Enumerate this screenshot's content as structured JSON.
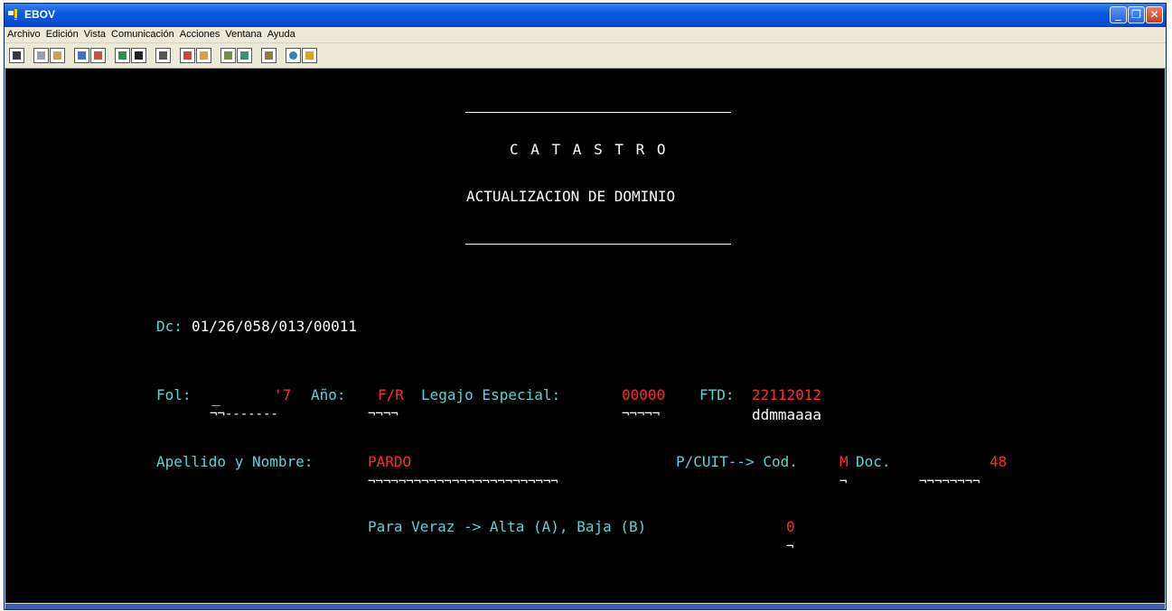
{
  "window": {
    "title": "EBOV",
    "icon": "terminal-app-icon"
  },
  "menu": [
    "Archivo",
    "Edición",
    "Vista",
    "Comunicación",
    "Acciones",
    "Ventana",
    "Ayuda"
  ],
  "toolbar": {
    "count": 20
  },
  "screen": {
    "heading": "C A T A S T R O",
    "subheading": "ACTUALIZACION DE DOMINIO",
    "dc_label": "Dc:",
    "dc_value": "01/26/058/013/00011",
    "fol_label": "Fol:",
    "fol_value": "_",
    "fol_value2": "'7",
    "fol_underline": "¬¬-------",
    "anio_label": "Año:",
    "anio_value": "F/R",
    "anio_underline": "¬¬¬¬",
    "legajo_label": "Legajo Especial:",
    "legajo_value": "00000",
    "legajo_underline": "¬¬¬¬¬",
    "ftd_label": "FTD:",
    "ftd_value": "22112012",
    "ftd_hint": "ddmmaaaa",
    "nombre_label": "Apellido y Nombre:",
    "nombre_value": "PARDO",
    "nombre_underline": "¬¬¬¬¬¬¬¬¬¬¬¬¬¬¬¬¬¬¬¬¬¬¬¬¬",
    "cuit_label": "P/CUIT--> Cod.",
    "cod_value": "M",
    "cod_underline": "¬",
    "doc_label": "Doc.",
    "doc_value": "48",
    "doc_underline": "¬¬¬¬¬¬¬¬",
    "veraz_label": "Para Veraz -> Alta (A), Baja (B)",
    "veraz_value": "0",
    "veraz_underline": "¬"
  }
}
